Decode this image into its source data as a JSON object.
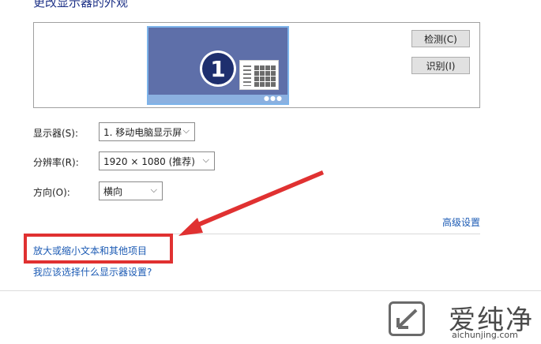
{
  "header": {
    "title": "更改显示器的外观"
  },
  "preview": {
    "monitor_number": "1",
    "detect_button": "检测(C)",
    "identify_button": "识别(I)"
  },
  "fields": {
    "display": {
      "label": "显示器(S):",
      "value": "1. 移动电脑显示屏"
    },
    "resolution": {
      "label": "分辨率(R):",
      "value": "1920 × 1080 (推荐)"
    },
    "orientation": {
      "label": "方向(O):",
      "value": "横向"
    }
  },
  "links": {
    "advanced": "高级设置",
    "scale_text": "放大或缩小文本和其他项目",
    "help": "我应该选择什么显示器设置?"
  },
  "watermark": {
    "brand": "爱纯净",
    "domain": "aichunjing.com"
  },
  "colors": {
    "link": "#1c5bb4",
    "highlight": "#e03131",
    "monitor_screen": "#5e6fa9",
    "monitor_border": "#7eb4ea"
  },
  "icons": {
    "monitor": "monitor-icon",
    "chevron": "chevron-down-icon",
    "arrow": "red-arrow-annotation"
  }
}
